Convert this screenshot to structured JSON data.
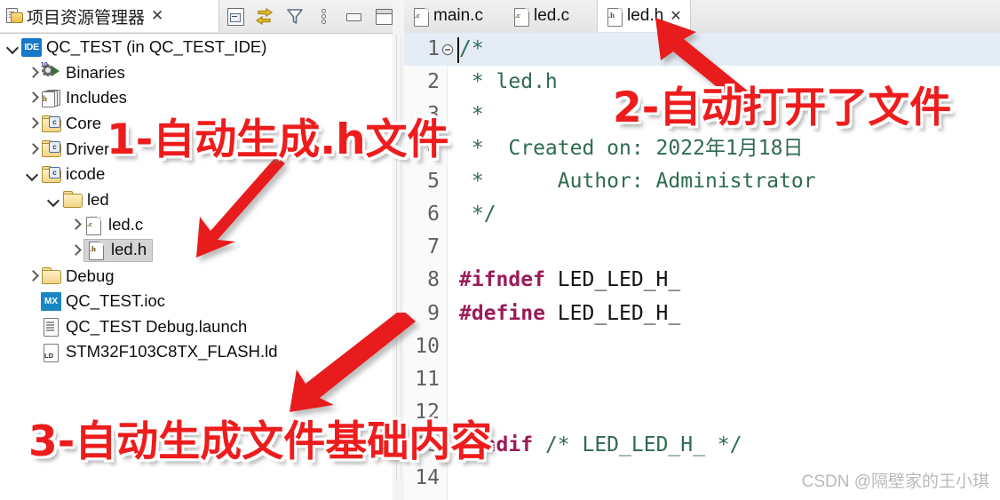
{
  "left_panel": {
    "tab_title": "项目资源管理器",
    "tab_close": "✕",
    "toolbar": [
      {
        "name": "collapse-all-icon",
        "tooltip": "Collapse All"
      },
      {
        "name": "link-with-editor-icon",
        "tooltip": "Link with Editor"
      },
      {
        "name": "filter-icon",
        "tooltip": "Filters"
      },
      {
        "name": "view-menu-icon",
        "tooltip": "View Menu"
      },
      {
        "name": "minimize-icon",
        "tooltip": "Minimize"
      },
      {
        "name": "maximize-icon",
        "tooltip": "Maximize"
      }
    ],
    "tree": [
      {
        "label": "QC_TEST (in QC_TEST_IDE)",
        "icon": "ide-project-icon",
        "state": "open",
        "depth": 0,
        "selected": false
      },
      {
        "label": "Binaries",
        "icon": "binaries-icon",
        "state": "closed",
        "depth": 1,
        "selected": false
      },
      {
        "label": "Includes",
        "icon": "includes-icon",
        "state": "closed",
        "depth": 1,
        "selected": false
      },
      {
        "label": "Core",
        "icon": "c-folder-icon",
        "state": "closed",
        "depth": 1,
        "selected": false
      },
      {
        "label": "Drivers",
        "icon": "c-folder-icon",
        "state": "closed",
        "depth": 1,
        "selected": false
      },
      {
        "label": "icode",
        "icon": "c-folder-icon",
        "state": "open",
        "depth": 1,
        "selected": false
      },
      {
        "label": "led",
        "icon": "folder-icon",
        "state": "open",
        "depth": 2,
        "selected": false
      },
      {
        "label": "led.c",
        "icon": "c-file-icon",
        "state": "closed",
        "depth": 3,
        "selected": false
      },
      {
        "label": "led.h",
        "icon": "h-file-icon",
        "state": "closed",
        "depth": 3,
        "selected": true
      },
      {
        "label": "Debug",
        "icon": "folder-icon",
        "state": "closed",
        "depth": 1,
        "selected": false
      },
      {
        "label": "QC_TEST.ioc",
        "icon": "mx-ioc-icon",
        "state": "none",
        "depth": 1,
        "selected": false
      },
      {
        "label": "QC_TEST Debug.launch",
        "icon": "launch-file-icon",
        "state": "none",
        "depth": 1,
        "selected": false
      },
      {
        "label": "STM32F103C8TX_FLASH.ld",
        "icon": "ld-file-icon",
        "state": "none",
        "depth": 1,
        "selected": false
      }
    ]
  },
  "editor": {
    "tabs": [
      {
        "label": "main.c",
        "icon": "c-file-icon",
        "active": false,
        "closable": false
      },
      {
        "label": "led.c",
        "icon": "c-file-icon",
        "active": false,
        "closable": false
      },
      {
        "label": "led.h",
        "icon": "h-file-icon",
        "active": true,
        "closable": true,
        "close": "✕"
      }
    ],
    "lines": [
      {
        "num": "1",
        "text": "/*",
        "kind": "cmt",
        "current": true,
        "fold": true
      },
      {
        "num": "2",
        "text": " * led.h",
        "kind": "cmt",
        "current": false,
        "fold": false
      },
      {
        "num": "3",
        "text": " *",
        "kind": "cmt",
        "current": false,
        "fold": false
      },
      {
        "num": "4",
        "text": " *  Created on: 2022年1月18日",
        "kind": "cmt",
        "current": false,
        "fold": false
      },
      {
        "num": "5",
        "text": " *      Author: Administrator",
        "kind": "cmt",
        "current": false,
        "fold": false
      },
      {
        "num": "6",
        "text": " */",
        "kind": "cmt",
        "current": false,
        "fold": false
      },
      {
        "num": "7",
        "text": "",
        "kind": "plain",
        "current": false,
        "fold": false
      },
      {
        "num": "8",
        "text": "#ifndef",
        "text2": " LED_LED_H_",
        "kind": "pre",
        "current": false,
        "fold": false
      },
      {
        "num": "9",
        "text": "#define",
        "text2": " LED_LED_H_",
        "kind": "pre",
        "current": false,
        "fold": false
      },
      {
        "num": "10",
        "text": "",
        "kind": "plain",
        "current": false,
        "fold": false
      },
      {
        "num": "11",
        "text": "",
        "kind": "plain",
        "current": false,
        "fold": false
      },
      {
        "num": "12",
        "text": "",
        "kind": "plain",
        "current": false,
        "fold": false
      },
      {
        "num": "13",
        "text": "#endif",
        "text2": " /* LED_LED_H_ */",
        "kind": "pre",
        "current": false,
        "fold": false
      },
      {
        "num": "14",
        "text": "",
        "kind": "plain",
        "current": false,
        "fold": false
      }
    ]
  },
  "annotations": {
    "one": "1-自动生成.h文件",
    "two": "2-自动打开了文件",
    "three": "3-自动生成文件基础内容",
    "color": "#ee1c1c"
  },
  "watermark": "CSDN @隔壁家的王小琪"
}
